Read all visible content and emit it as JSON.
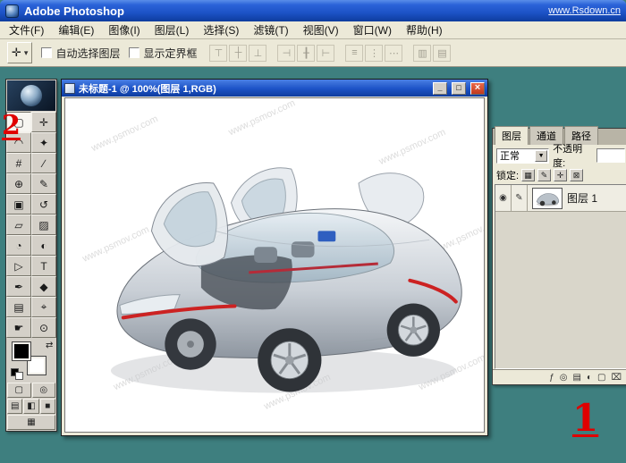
{
  "titlebar": {
    "title": "Adobe Photoshop",
    "watermark": "www.Rsdown.cn"
  },
  "menubar": {
    "items": [
      {
        "name": "file",
        "label": "文件(F)"
      },
      {
        "name": "edit",
        "label": "编辑(E)"
      },
      {
        "name": "image",
        "label": "图像(I)"
      },
      {
        "name": "layer",
        "label": "图层(L)"
      },
      {
        "name": "select",
        "label": "选择(S)"
      },
      {
        "name": "filter",
        "label": "滤镜(T)"
      },
      {
        "name": "view",
        "label": "视图(V)"
      },
      {
        "name": "window",
        "label": "窗口(W)"
      },
      {
        "name": "help",
        "label": "帮助(H)"
      }
    ]
  },
  "optionsbar": {
    "tool_preset_glyph": "✛",
    "dropdown_glyph": "▾",
    "auto_select_label": "自动选择图层",
    "show_bbox_label": "显示定界框",
    "align_groups": [
      [
        {
          "name": "align-top-edges",
          "glyph": "⊤"
        },
        {
          "name": "align-vertical-centers",
          "glyph": "┼"
        },
        {
          "name": "align-bottom-edges",
          "glyph": "⊥"
        }
      ],
      [
        {
          "name": "align-left-edges",
          "glyph": "⊣"
        },
        {
          "name": "align-horizontal-centers",
          "glyph": "╂"
        },
        {
          "name": "align-right-edges",
          "glyph": "⊢"
        }
      ],
      [
        {
          "name": "distribute-top-edges",
          "glyph": "≡"
        },
        {
          "name": "distribute-vertical-centers",
          "glyph": "⋮"
        },
        {
          "name": "distribute-bottom-edges",
          "glyph": "⋯"
        }
      ],
      [
        {
          "name": "distribute-left-edges",
          "glyph": "▥"
        },
        {
          "name": "distribute-horizontal-centers",
          "glyph": "▤"
        }
      ]
    ]
  },
  "toolbox": {
    "foreground": "#000000",
    "background": "#ffffff",
    "swap_glyph": "⇄",
    "tools": [
      {
        "name": "rectangular-marquee-tool",
        "glyph": "▢",
        "active": true
      },
      {
        "name": "move-tool",
        "glyph": "✛",
        "active": false
      },
      {
        "name": "lasso-tool",
        "glyph": "◠",
        "active": false
      },
      {
        "name": "magic-wand-tool",
        "glyph": "✦",
        "active": false
      },
      {
        "name": "crop-tool",
        "glyph": "#",
        "active": false
      },
      {
        "name": "slice-tool",
        "glyph": "∕",
        "active": false
      },
      {
        "name": "healing-brush-tool",
        "glyph": "⊕",
        "active": false
      },
      {
        "name": "brush-tool",
        "glyph": "✎",
        "active": false
      },
      {
        "name": "clone-stamp-tool",
        "glyph": "▣",
        "active": false
      },
      {
        "name": "history-brush-tool",
        "glyph": "↺",
        "active": false
      },
      {
        "name": "eraser-tool",
        "glyph": "▱",
        "active": false
      },
      {
        "name": "gradient-tool",
        "glyph": "▨",
        "active": false
      },
      {
        "name": "blur-tool",
        "glyph": "◔",
        "active": false
      },
      {
        "name": "dodge-tool",
        "glyph": "◐",
        "active": false
      },
      {
        "name": "path-selection-tool",
        "glyph": "▷",
        "active": false
      },
      {
        "name": "type-tool",
        "glyph": "T",
        "active": false
      },
      {
        "name": "pen-tool",
        "glyph": "✒",
        "active": false
      },
      {
        "name": "custom-shape-tool",
        "glyph": "◆",
        "active": false
      },
      {
        "name": "notes-tool",
        "glyph": "▤",
        "active": false
      },
      {
        "name": "eyedropper-tool",
        "glyph": "⌖",
        "active": false
      },
      {
        "name": "hand-tool",
        "glyph": "☛",
        "active": false
      },
      {
        "name": "zoom-tool",
        "glyph": "⊙",
        "active": false
      }
    ],
    "mask_modes": [
      {
        "name": "standard-mode-button",
        "glyph": "▢"
      },
      {
        "name": "quick-mask-mode-button",
        "glyph": "◎"
      }
    ],
    "screen_modes": [
      {
        "name": "standard-screen-button",
        "glyph": "▤"
      },
      {
        "name": "fullscreen-menubar-button",
        "glyph": "◧"
      },
      {
        "name": "fullscreen-button",
        "glyph": "■"
      }
    ],
    "imageready": {
      "name": "jump-to-imageready-button",
      "glyph": "▦"
    }
  },
  "document": {
    "title": "未标题-1 @ 100%(图层 1,RGB)",
    "canvas_watermark": "www.psmov.com",
    "window_buttons": {
      "minimize": "_",
      "maximize": "□",
      "close": "×"
    }
  },
  "layers_panel": {
    "tabs": [
      {
        "name": "layers",
        "label": "图层",
        "active": true
      },
      {
        "name": "channels",
        "label": "通道",
        "active": false
      },
      {
        "name": "paths",
        "label": "路径",
        "active": false
      }
    ],
    "blend_mode": "正常",
    "select_arrow": "▼",
    "opacity_label": "不透明度:",
    "lock_label": "锁定:",
    "lock_buttons": [
      {
        "name": "lock-transparency-button",
        "glyph": "▦"
      },
      {
        "name": "lock-image-button",
        "glyph": "✎"
      },
      {
        "name": "lock-position-button",
        "glyph": "✛"
      },
      {
        "name": "lock-all-button",
        "glyph": "⊠"
      }
    ],
    "layer": {
      "name_label": "图层 1",
      "eye_glyph": "◉",
      "paint_glyph": "✎"
    },
    "bottom_buttons": [
      {
        "name": "layer-effects-button",
        "glyph": "ƒ"
      },
      {
        "name": "layer-mask-button",
        "glyph": "◎"
      },
      {
        "name": "layer-set-button",
        "glyph": "▤"
      },
      {
        "name": "adjustment-layer-button",
        "glyph": "◐"
      },
      {
        "name": "new-layer-button",
        "glyph": "▢"
      },
      {
        "name": "delete-layer-button",
        "glyph": "⌧"
      }
    ]
  },
  "annotations": {
    "step_one": "1",
    "step_two": "2"
  },
  "colors": {
    "workspace_teal": "#3E7F7F",
    "xp_blue": "#1c52c6",
    "panel_gray": "#ECE9D8",
    "accent_red": "#E00000",
    "canvas_watermark_gray": "#DCDCDC"
  }
}
